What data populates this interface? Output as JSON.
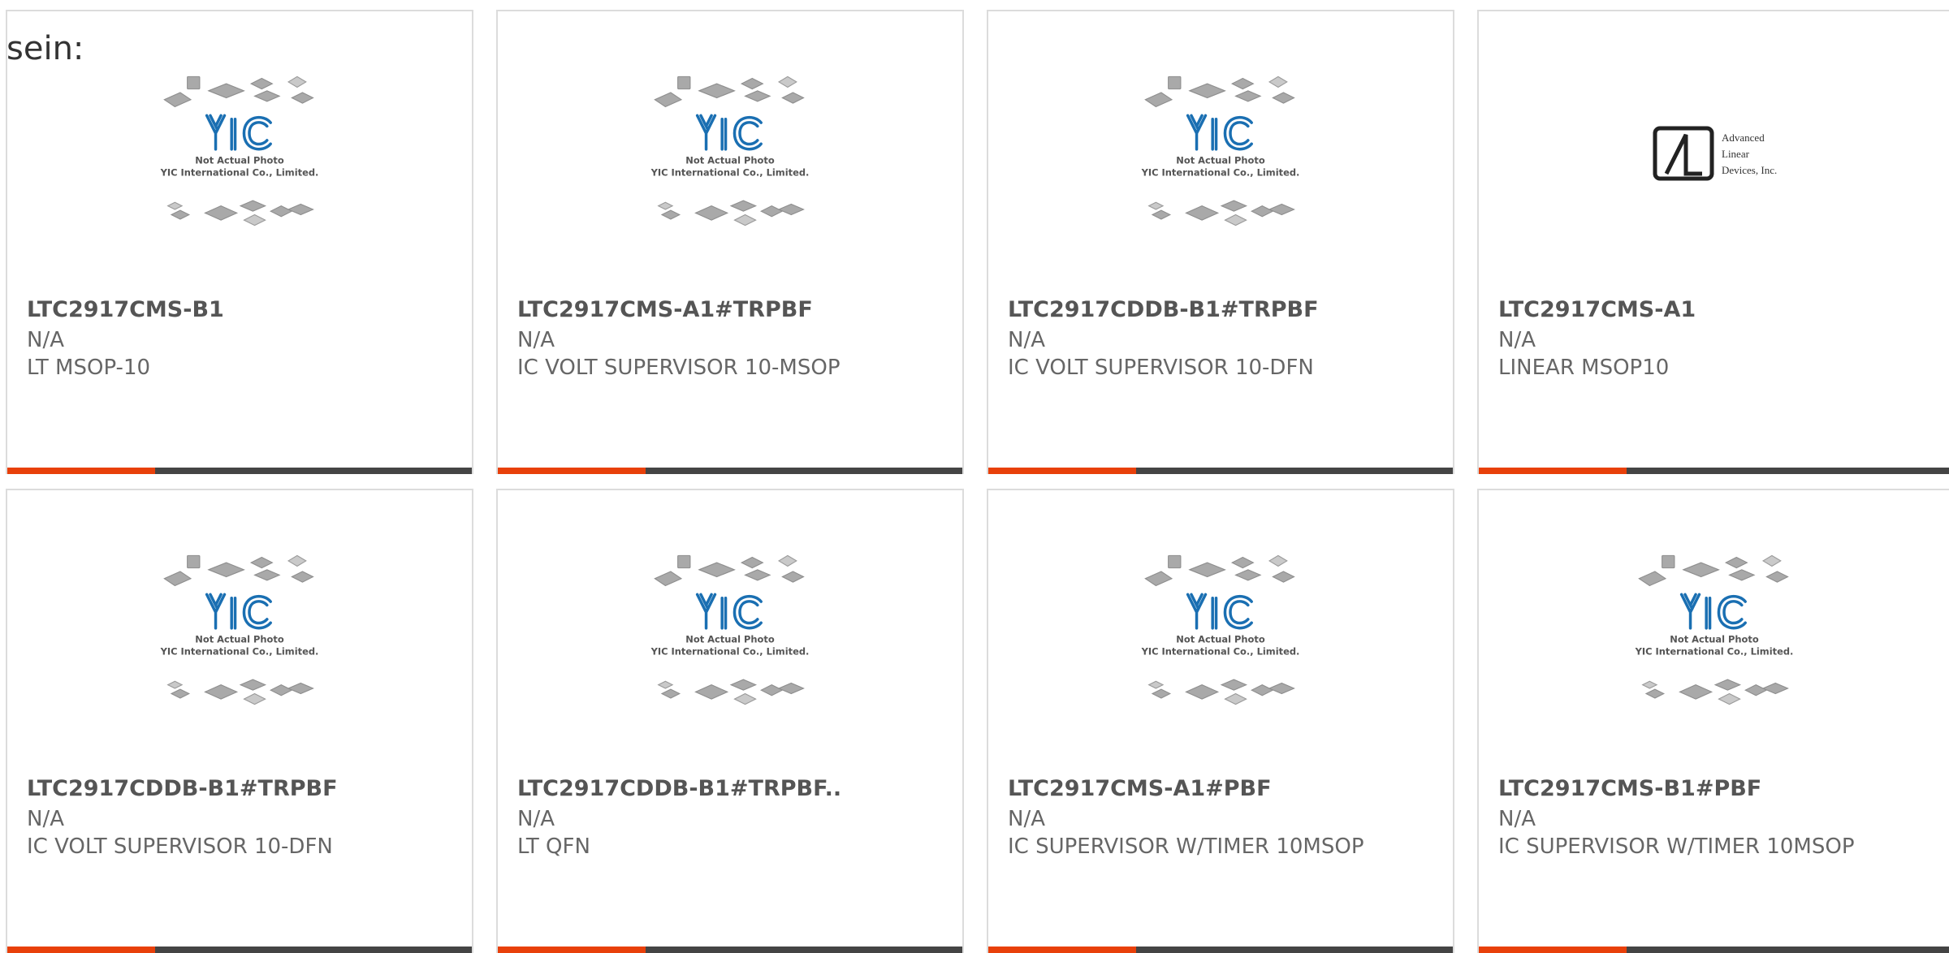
{
  "intro_text": "sein:",
  "placeholder_caption": [
    "Not Actual Photo",
    "YIC International Co., Limited."
  ],
  "ald_logo": [
    "Advanced",
    "Linear",
    "Devices, Inc."
  ],
  "products": [
    {
      "part": "LTC2917CMS-B1",
      "mfr": "N/A",
      "desc": "LT MSOP-10",
      "image": "yic-placeholder"
    },
    {
      "part": "LTC2917CMS-A1#TRPBF",
      "mfr": "N/A",
      "desc": "IC VOLT SUPERVISOR 10-MSOP",
      "image": "yic-placeholder"
    },
    {
      "part": "LTC2917CDDB-B1#TRPBF",
      "mfr": "N/A",
      "desc": "IC VOLT SUPERVISOR 10-DFN",
      "image": "yic-placeholder"
    },
    {
      "part": "LTC2917CMS-A1",
      "mfr": "N/A",
      "desc": "LINEAR MSOP10",
      "image": "ald-logo"
    },
    {
      "part": "LTC2917CDDB-B1#TRPBF",
      "mfr": "N/A",
      "desc": "IC VOLT SUPERVISOR 10-DFN",
      "image": "yic-placeholder"
    },
    {
      "part": "LTC2917CDDB-B1#TRPBF..",
      "mfr": "N/A",
      "desc": "LT QFN",
      "image": "yic-placeholder"
    },
    {
      "part": "LTC2917CMS-A1#PBF",
      "mfr": "N/A",
      "desc": "IC SUPERVISOR W/TIMER 10MSOP",
      "image": "yic-placeholder"
    },
    {
      "part": "LTC2917CMS-B1#PBF",
      "mfr": "N/A",
      "desc": "IC SUPERVISOR W/TIMER 10MSOP",
      "image": "yic-placeholder"
    }
  ],
  "colors": {
    "accent": "#e8400a",
    "bar": "#444444",
    "logo_blue": "#1a6fb2"
  }
}
